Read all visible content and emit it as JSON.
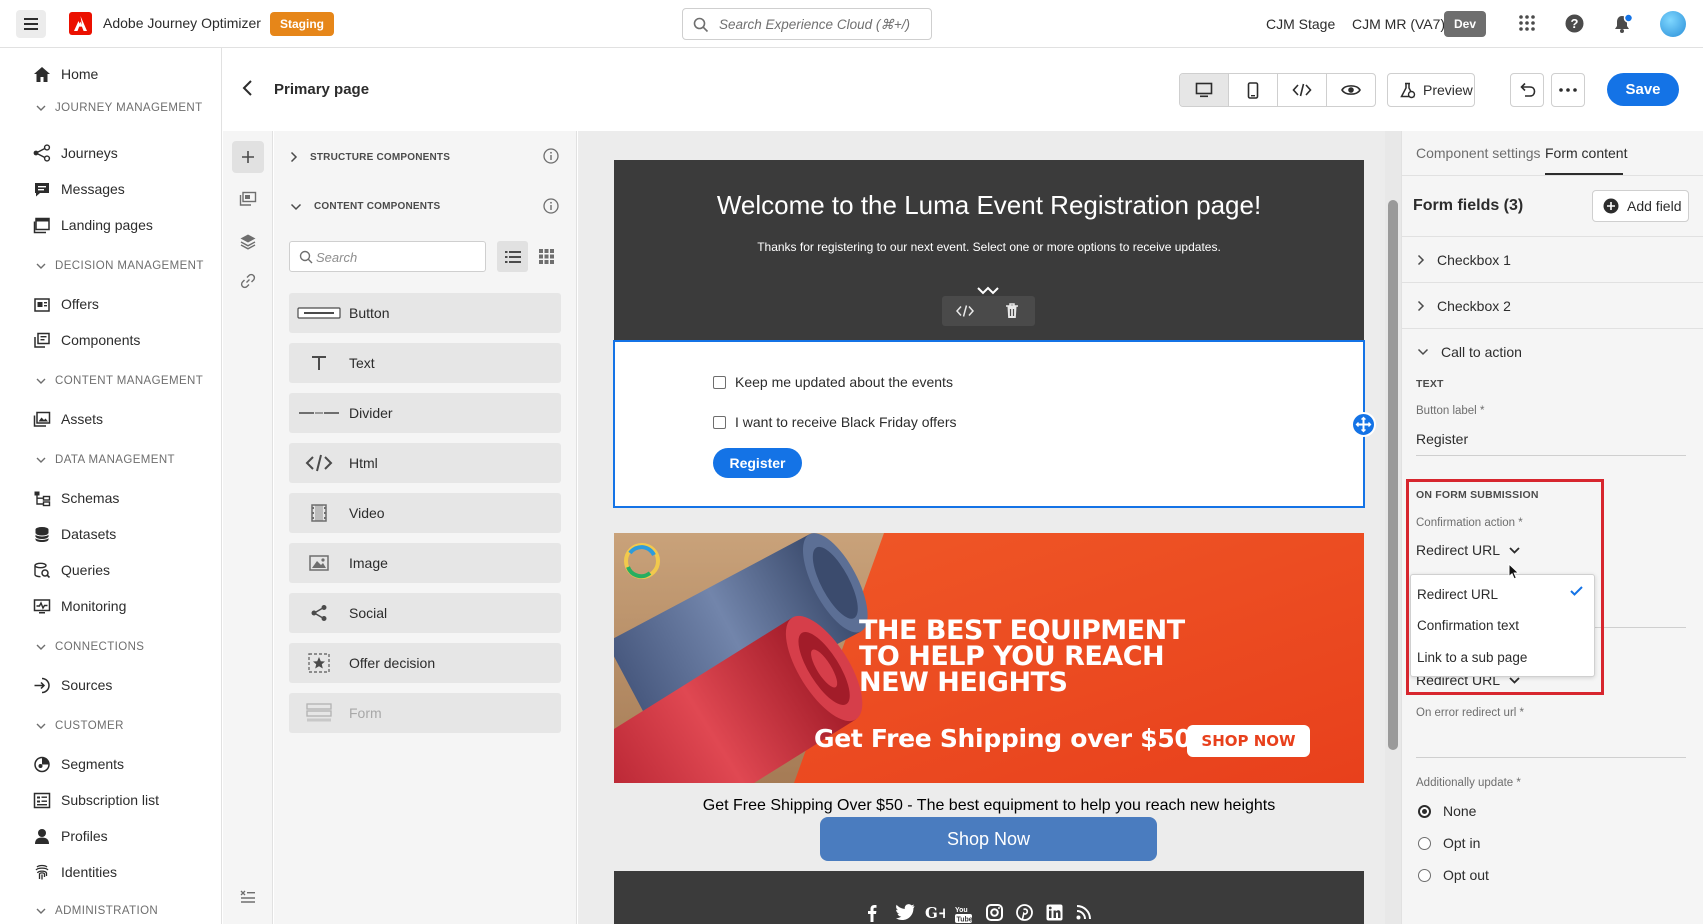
{
  "topbar": {
    "app_title": "Adobe Journey Optimizer",
    "env_badge": "Staging",
    "search_placeholder": "Search Experience Cloud (⌘+/)",
    "org_name": "CJM Stage",
    "sandbox_name": "CJM MR (VA7)",
    "sandbox_badge": "Dev",
    "icons": [
      "menu-icon",
      "adobe-logo",
      "search-icon",
      "apps-icon",
      "help-icon",
      "bell-icon",
      "avatar"
    ]
  },
  "nav": {
    "home": "Home",
    "sections": {
      "journey_management": "JOURNEY MANAGEMENT",
      "decision_management": "DECISION MANAGEMENT",
      "content_management": "CONTENT MANAGEMENT",
      "data_management": "DATA MANAGEMENT",
      "connections": "CONNECTIONS",
      "customer": "CUSTOMER",
      "administration": "ADMINISTRATION"
    },
    "items": {
      "journeys": "Journeys",
      "messages": "Messages",
      "landing_pages": "Landing pages",
      "offers": "Offers",
      "components": "Components",
      "assets": "Assets",
      "schemas": "Schemas",
      "datasets": "Datasets",
      "queries": "Queries",
      "monitoring": "Monitoring",
      "sources": "Sources",
      "segments": "Segments",
      "subscription_list": "Subscription list",
      "profiles": "Profiles",
      "identities": "Identities"
    }
  },
  "header": {
    "page_title": "Primary page",
    "preview_label": "Preview",
    "save_label": "Save"
  },
  "components_panel": {
    "structure_title": "STRUCTURE COMPONENTS",
    "content_title": "CONTENT COMPONENTS",
    "search_placeholder": "Search",
    "items": [
      "Button",
      "Text",
      "Divider",
      "Html",
      "Video",
      "Image",
      "Social",
      "Offer decision",
      "Form"
    ]
  },
  "canvas": {
    "hero_title": "Welcome to the Luma Event Registration page!",
    "hero_subtitle": "Thanks for registering to our next event. Select one or more options to receive updates.",
    "checkbox1_label": "Keep me updated about the events",
    "checkbox2_label": "I want to receive Black Friday offers",
    "register_label": "Register",
    "banner_line1": "THE BEST EQUIPMENT",
    "banner_line2": "TO HELP YOU REACH",
    "banner_line3": "NEW HEIGHTS",
    "banner_shipping": "Get Free Shipping over $50",
    "banner_shop": "SHOP NOW",
    "shipping_text": "Get Free Shipping Over $50 - The best equipment to help you reach new heights",
    "shop_now_label": "Shop Now"
  },
  "right_panel": {
    "tab_component_settings": "Component settings",
    "tab_form_content": "Form content",
    "form_fields_title": "Form fields (3)",
    "add_field_label": "Add field",
    "fields": [
      "Checkbox 1",
      "Checkbox 2",
      "Call to action"
    ],
    "text_heading": "TEXT",
    "button_label_label": "Button label",
    "button_label_value": "Register",
    "on_submission_heading": "ON FORM SUBMISSION",
    "confirmation_action_label": "Confirmation action",
    "confirmation_action_value": "Redirect URL",
    "dropdown_options": [
      "Redirect URL",
      "Confirmation text",
      "Link to a sub page"
    ],
    "dropdown_selected": "Redirect URL",
    "error_action_value": "Redirect URL",
    "on_error_redirect_label": "On error redirect url",
    "additionally_update_label": "Additionally update",
    "radio_options": [
      "None",
      "Opt in",
      "Opt out"
    ],
    "radio_selected": "None",
    "required_marker": "*"
  },
  "colors": {
    "accent": "#1473e6",
    "staging_badge": "#e68619",
    "highlight": "#d7262e",
    "hero_bg": "#3b3b3b",
    "banner_orange": "#ef4a22"
  }
}
